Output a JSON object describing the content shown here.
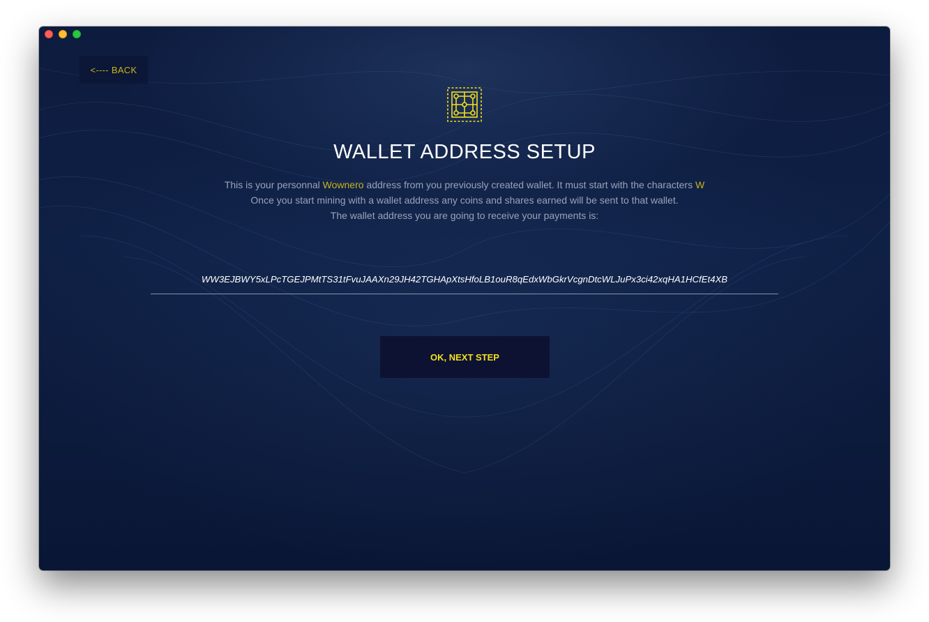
{
  "window": {
    "controls": [
      "close",
      "minimize",
      "maximize"
    ]
  },
  "nav": {
    "back_label": "<---- BACK"
  },
  "header": {
    "logo_icon": "circuit-wallet-icon",
    "title": "WALLET ADDRESS SETUP"
  },
  "description": {
    "line1_prefix": "This is your personnal ",
    "coin_name": "Wownero",
    "line1_middle": " address from you previously created wallet. It must start with the characters ",
    "start_char": "W",
    "line2": "Once you start mining with a wallet address any coins and shares earned will be sent to that wallet.",
    "line3": "The wallet address you are going to receive your payments is:"
  },
  "wallet": {
    "address": "WW3EJBWY5xLPcTGEJPMtTS31tFvuJAAXn29JH42TGHApXtsHfoLB1ouR8qEdxWbGkrVcgnDtcWLJuPx3ci42xqHA1HCfEt4XB"
  },
  "actions": {
    "next_label": "OK, NEXT STEP"
  },
  "colors": {
    "accent": "#c9b51c",
    "button_text": "#f4e01a",
    "background": "#0d1b3e"
  }
}
